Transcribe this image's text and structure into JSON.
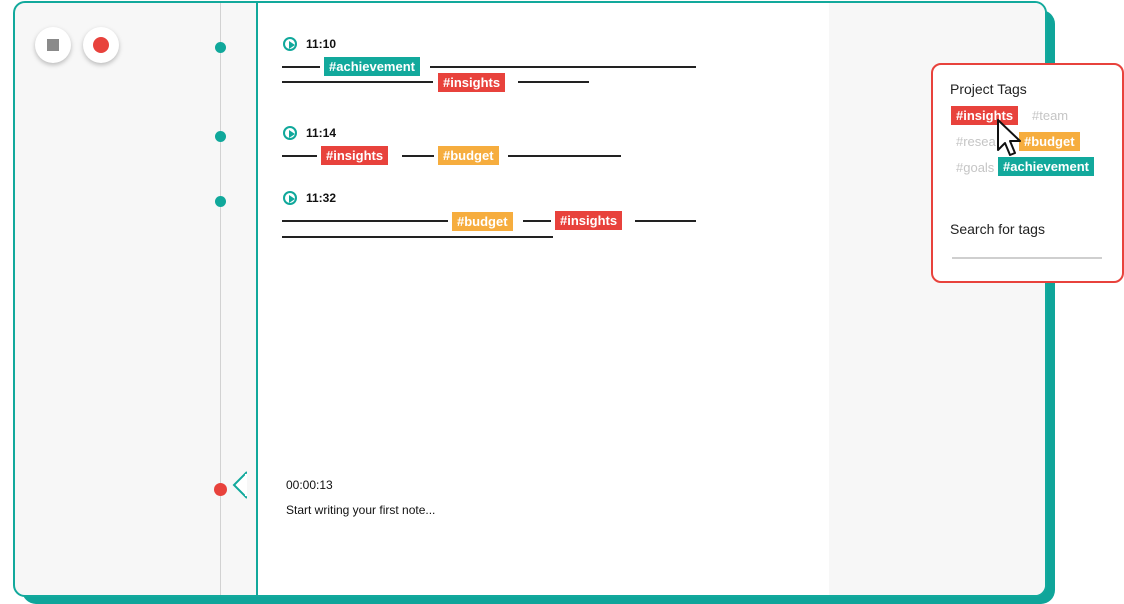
{
  "controls": {
    "stop_icon": "stop-square",
    "record_icon": "record-dot"
  },
  "entries": [
    {
      "time": "11:10",
      "tags": [
        "#achievement",
        "#insights"
      ]
    },
    {
      "time": "11:14",
      "tags": [
        "#insights",
        "#budget"
      ]
    },
    {
      "time": "11:32",
      "tags": [
        "#budget",
        "#insights"
      ]
    }
  ],
  "draft": {
    "timer": "00:00:13",
    "placeholder": "Start writing your first note..."
  },
  "project_tags": {
    "title": "Project Tags",
    "tags": [
      {
        "label": "#insights",
        "active": true,
        "color": "#e8423c"
      },
      {
        "label": "#team",
        "active": false
      },
      {
        "label": "#resea",
        "active": false
      },
      {
        "label": "#budget",
        "active": true,
        "color": "#f6ad3e"
      },
      {
        "label": "#goals",
        "active": false
      },
      {
        "label": "#achievement",
        "active": true,
        "color": "#12a99c"
      }
    ],
    "search_label": "Search for tags",
    "search_value": ""
  },
  "colors": {
    "accent": "#12a99c",
    "alert": "#e8423c",
    "warn": "#f6ad3e"
  }
}
